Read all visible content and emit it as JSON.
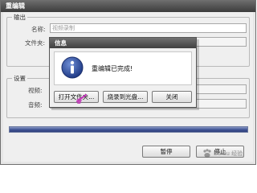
{
  "window": {
    "title": "重编辑"
  },
  "output_group": {
    "title": "输出",
    "name_label": "名称:",
    "name_value": "视频录制",
    "folder_label": "文件夹:"
  },
  "settings_group": {
    "title": "设置",
    "video_label": "视频:",
    "audio_label": "音频:"
  },
  "progress": {
    "value": 1.0
  },
  "buttons": {
    "pause": "暂停",
    "stop": "停止"
  },
  "dialog": {
    "title": "信息",
    "message": "重编辑已完成!",
    "open_folder": "打开文件夹...",
    "burn_disc": "烧录到光盘...",
    "close": "关闭"
  },
  "watermark": "Baidu 经验",
  "colors": {
    "titlebar": "#4a4a4a",
    "progress": "#3f5394",
    "info_icon": "#2f4e9c",
    "cursor": "#c23ab8"
  },
  "icons": [
    "info-icon",
    "mouse-cursor-icon"
  ]
}
